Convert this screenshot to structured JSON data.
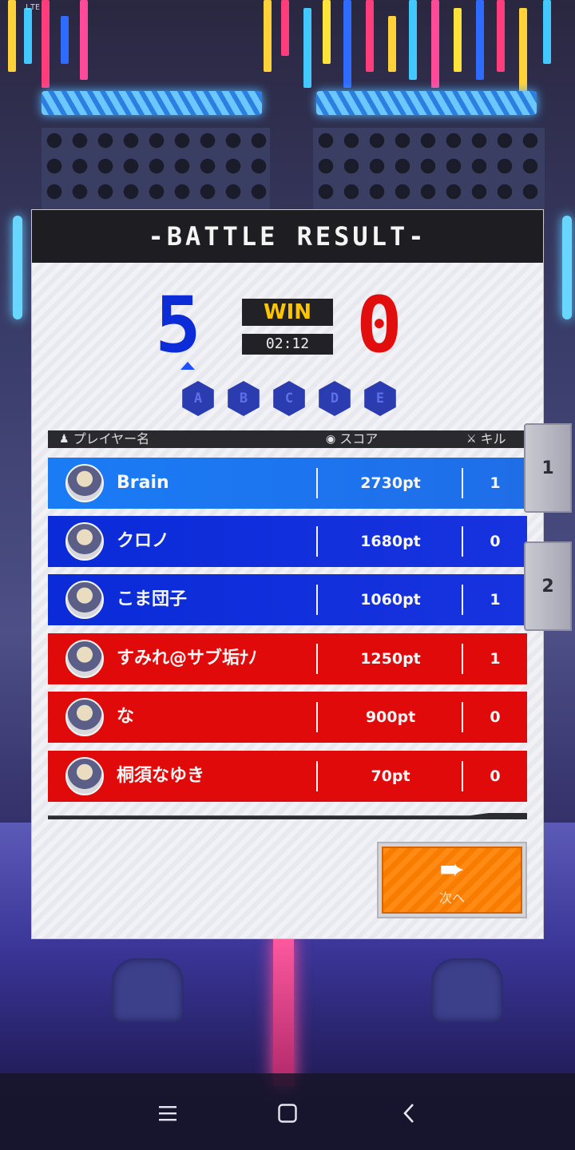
{
  "status_bar": {
    "text": "LTE"
  },
  "panel": {
    "title": "-BATTLE RESULT-",
    "blue_score": "5",
    "red_score": "0",
    "result": "WIN",
    "time": "02:12",
    "rounds": [
      "A",
      "B",
      "C",
      "D",
      "E"
    ]
  },
  "table": {
    "headers": {
      "player": "プレイヤー名",
      "score": "スコア",
      "kill": "キル"
    },
    "rows": [
      {
        "team": "blue",
        "name": "Brain",
        "score": "2730pt",
        "kills": "1"
      },
      {
        "team": "blue",
        "name": "クロノ",
        "score": "1680pt",
        "kills": "0"
      },
      {
        "team": "blue",
        "name": "こま団子",
        "score": "1060pt",
        "kills": "1"
      },
      {
        "team": "red",
        "name": "すみれ@サブ垢ﾅﾉ",
        "score": "1250pt",
        "kills": "1"
      },
      {
        "team": "red",
        "name": "な",
        "score": "900pt",
        "kills": "0"
      },
      {
        "team": "red",
        "name": "桐須なゆき",
        "score": "70pt",
        "kills": "0"
      }
    ]
  },
  "next_button": {
    "label": "次へ",
    "icon": "arrow-right-icon"
  },
  "team_tabs": [
    "1",
    "2"
  ],
  "colors": {
    "blue_team": "#0b2cd6",
    "red_team": "#e20d0d",
    "win": "#ffc400",
    "next": "#f77c00"
  },
  "navbar": {
    "menu_icon": "menu-icon",
    "home_icon": "home-icon",
    "back_icon": "back-icon"
  }
}
